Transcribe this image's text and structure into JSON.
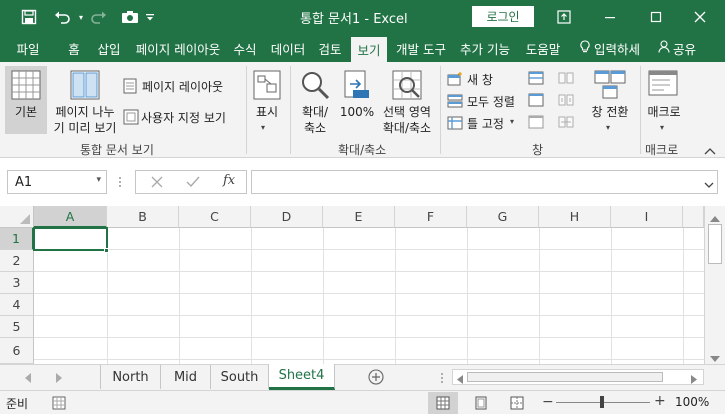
{
  "titlebar": {
    "title": "통합 문서1  -  Excel",
    "login_label": "로그인"
  },
  "tabs": [
    "파일",
    "홈",
    "삽입",
    "페이지 레이아웃",
    "수식",
    "데이터",
    "검토",
    "보기",
    "개발 도구",
    "추가 기능",
    "도움말",
    "입력하세",
    "공유"
  ],
  "active_tab": "보기",
  "ribbon": {
    "normal": "기본",
    "page_break_1": "페이지 나누",
    "page_break_2": "기 미리 보기",
    "page_layout": "페이지 레이아웃",
    "custom_views": "사용자 지정 보기",
    "group_workbook_views": "통합 문서 보기",
    "show": "표시",
    "zoom_1": "확대/",
    "zoom_2": "축소",
    "zoom_100": "100%",
    "zoom_sel_1": "선택 영역",
    "zoom_sel_2": "확대/축소",
    "group_zoom": "확대/축소",
    "new_window": "새 창",
    "arrange_all": "모두 정렬",
    "freeze_panes": "틀 고정",
    "group_window": "창",
    "switch_windows": "창 전환",
    "macros": "매크로",
    "group_macros": "매크로"
  },
  "formula_bar": {
    "name_box": "A1",
    "fx": "fx",
    "formula": ""
  },
  "grid": {
    "columns": [
      "A",
      "B",
      "C",
      "D",
      "E",
      "F",
      "G",
      "H",
      "I"
    ],
    "rows": [
      "1",
      "2",
      "3",
      "4",
      "5",
      "6"
    ]
  },
  "sheets": [
    "North",
    "Mid",
    "South",
    "Sheet4"
  ],
  "active_sheet": "Sheet4",
  "status": {
    "ready": "준비",
    "zoom": "100%"
  },
  "colors": {
    "accent": "#217346"
  }
}
